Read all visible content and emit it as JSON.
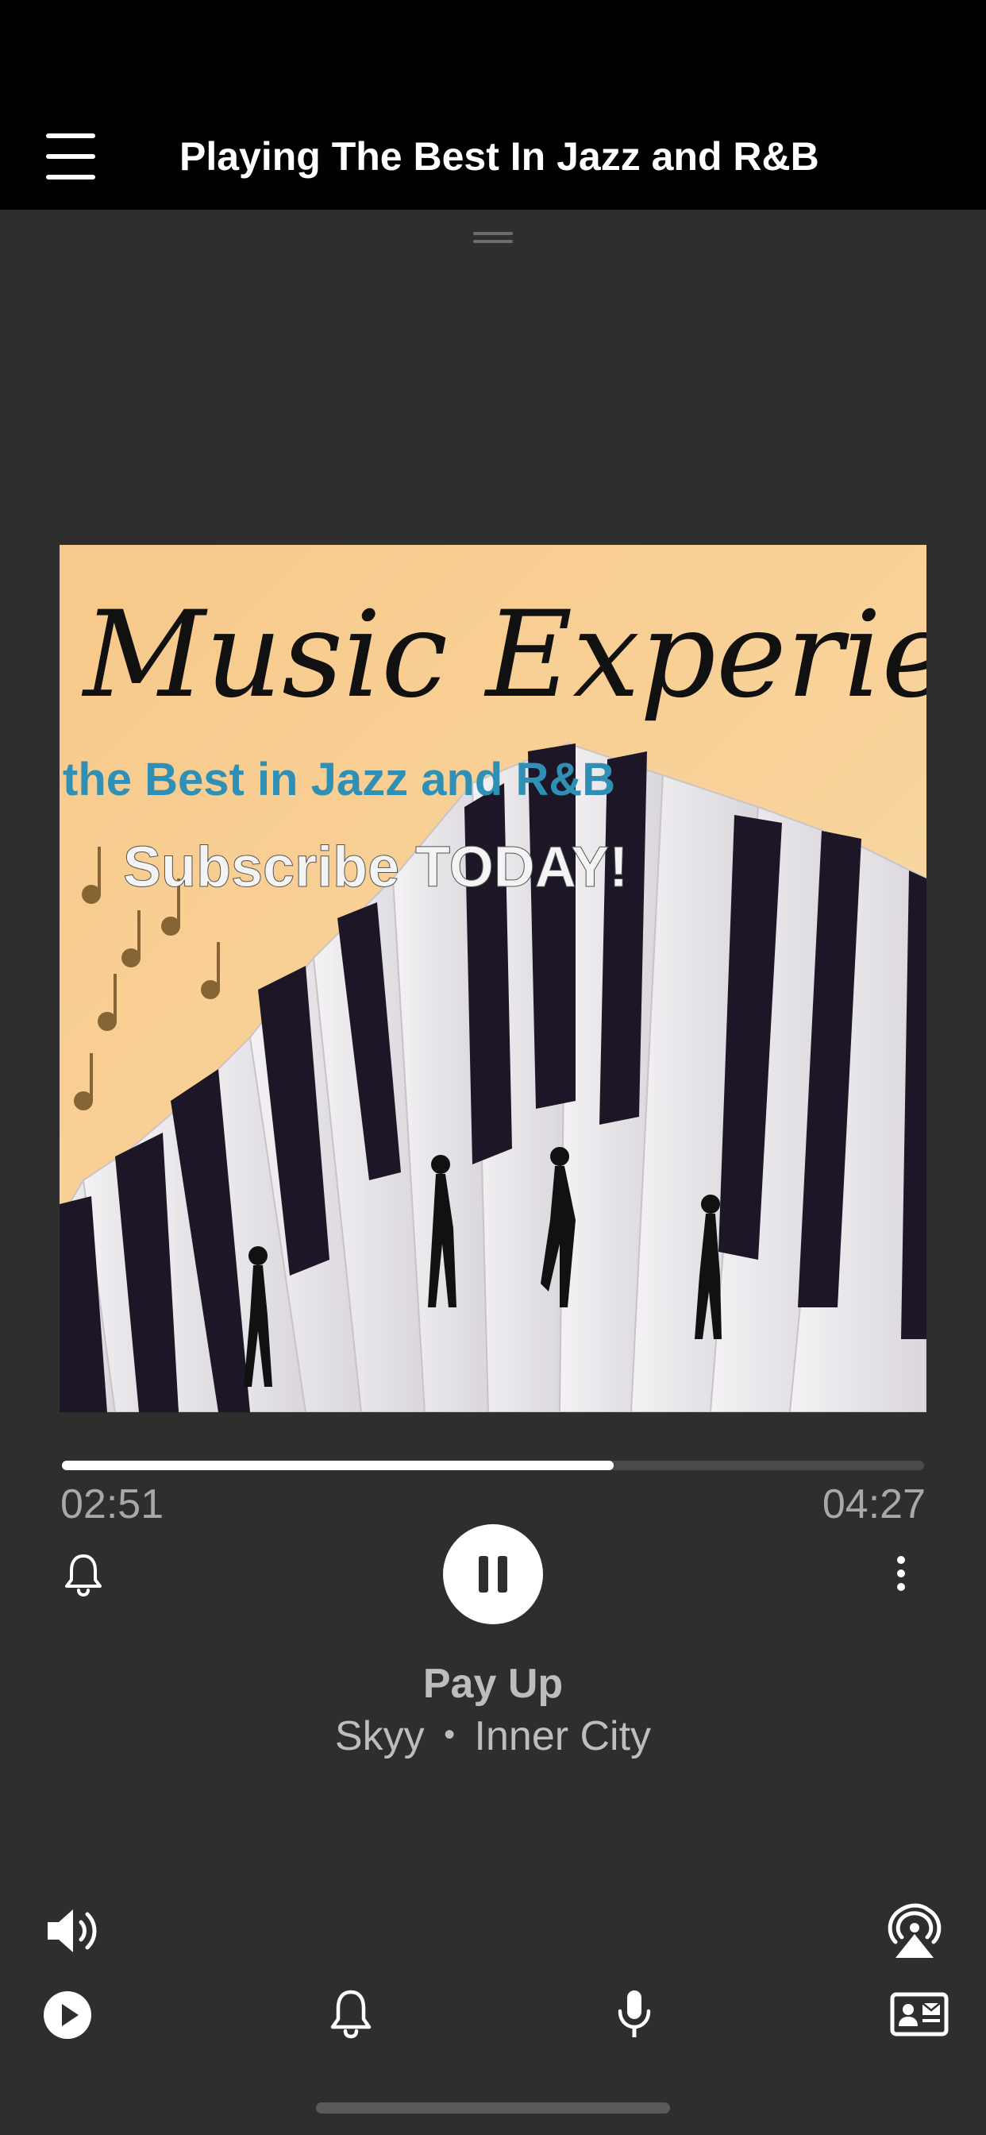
{
  "header": {
    "title": "Playing The Best In Jazz and R&B",
    "menu_icon": "hamburger-menu-icon"
  },
  "artwork": {
    "title_text": "Music Experience",
    "tagline": "the Best in Jazz and R&B",
    "cta": "Subscribe TODAY!"
  },
  "player": {
    "elapsed": "02:51",
    "duration": "04:27",
    "progress": 0.64,
    "state": "playing",
    "track_title": "Pay Up",
    "artist": "Skyy",
    "separator": "•",
    "album": "Inner City"
  },
  "controls": {
    "left_icon": "bell-icon",
    "center_icon": "pause-icon",
    "right_icon": "more-vertical-icon"
  },
  "bottom_bar": {
    "row1": [
      "volume-icon",
      "airplay-icon"
    ],
    "row2": [
      "play-circle-icon",
      "bell-icon",
      "microphone-icon",
      "contact-card-icon"
    ]
  },
  "colors": {
    "background": "#2e2e2e",
    "header": "#000000",
    "text_primary": "#ffffff",
    "text_secondary": "#bdbdbd",
    "art_background": "#f5c987"
  }
}
